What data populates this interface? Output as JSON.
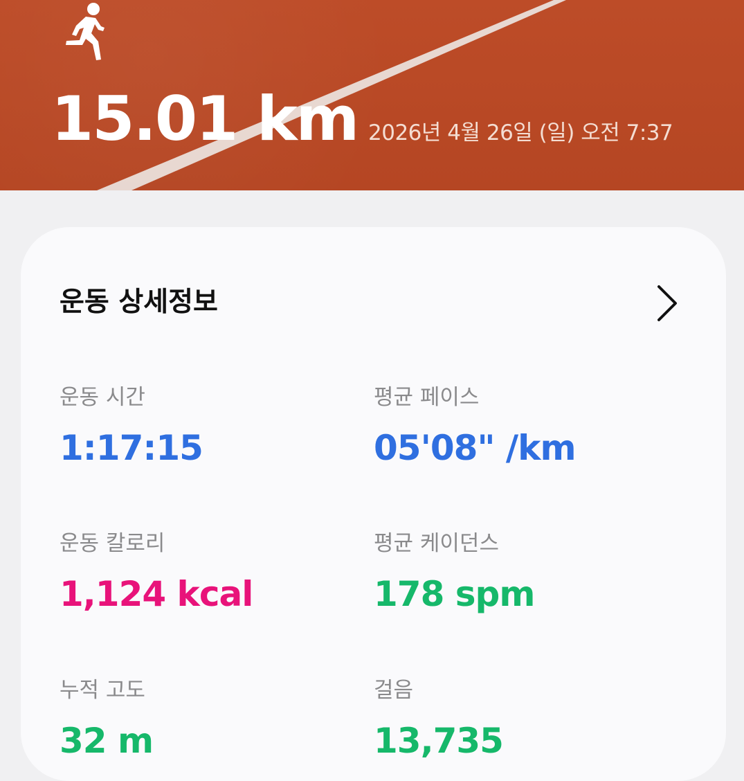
{
  "header": {
    "distance": "15.01 km",
    "datetime": "2026년 4월 26일 (일) 오전 7:37",
    "icon": "runner-icon"
  },
  "card": {
    "title": "운동 상세정보",
    "stats": [
      {
        "label": "운동 시간",
        "value": "1:17:15",
        "color": "#2f6fe0"
      },
      {
        "label": "평균 페이스",
        "value": "05'08\" /km",
        "color": "#2f6fe0"
      },
      {
        "label": "운동 칼로리",
        "value": "1,124 kcal",
        "color": "#e8137a"
      },
      {
        "label": "평균 케이던스",
        "value": "178 spm",
        "color": "#16b86a"
      },
      {
        "label": "누적 고도",
        "value": "32 m",
        "color": "#16b86a"
      },
      {
        "label": "걸음",
        "value": "13,735",
        "color": "#16b86a"
      }
    ]
  },
  "colors": {
    "track": "#b94a26",
    "line": "#e9e2df",
    "background": "#f0f0f2",
    "card": "#fafafc"
  }
}
